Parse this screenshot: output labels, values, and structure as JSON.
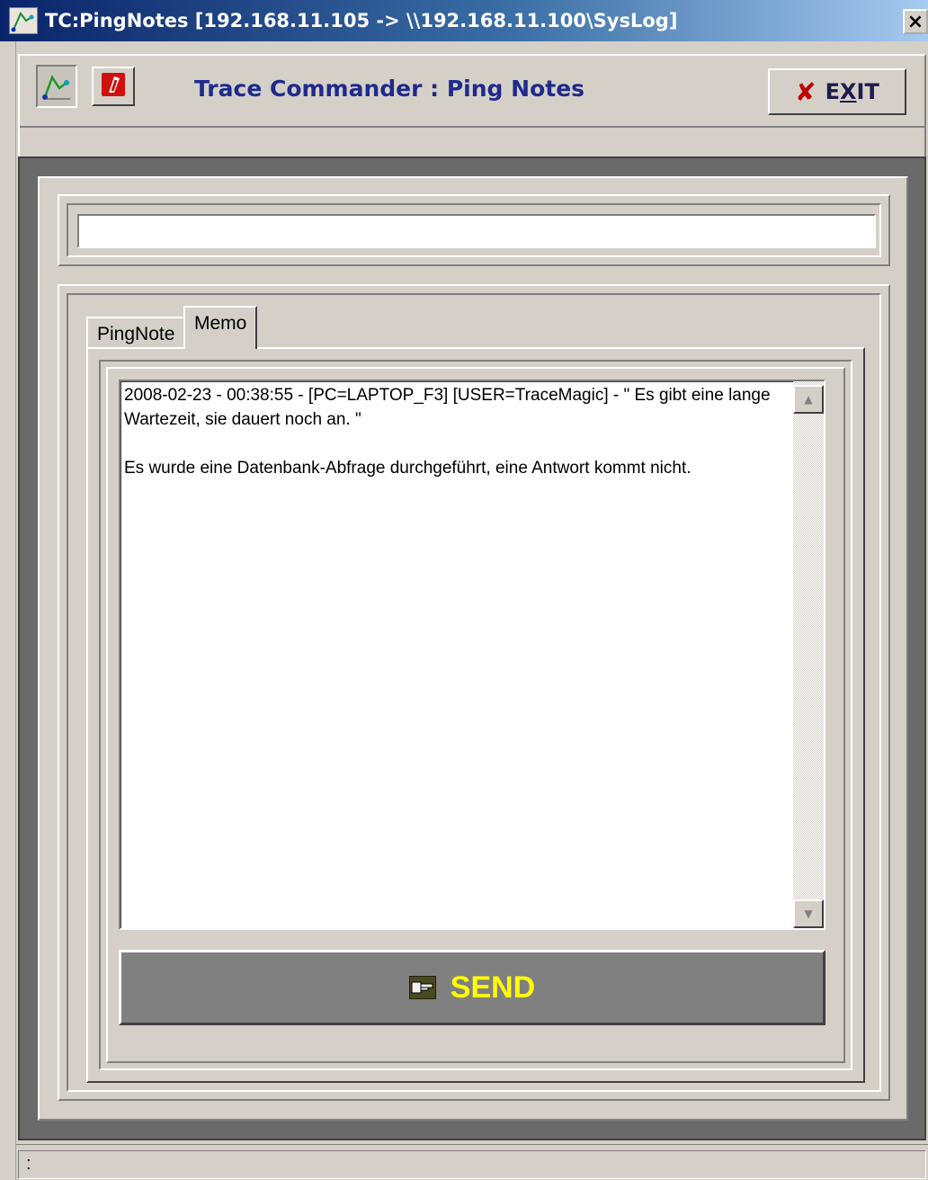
{
  "window": {
    "title": "TC:PingNotes [192.168.11.105 -> \\\\192.168.11.100\\SysLog]",
    "close_glyph": "×"
  },
  "toolbar": {
    "heading": "Trace Commander : Ping Notes",
    "exit_prefix": "E",
    "exit_underlined": "X",
    "exit_suffix": "IT",
    "icons": [
      "chart-icon",
      "ping-icon",
      "exit-x-icon"
    ]
  },
  "address": {
    "value": ""
  },
  "tabs": [
    {
      "label": "PingNote",
      "active": false
    },
    {
      "label": "Memo",
      "active": true
    }
  ],
  "memo": {
    "text": "2008-02-23 - 00:38:55 - [PC=LAPTOP_F3] [USER=TraceMagic] - \" Es gibt eine lange Wartezeit, sie dauert noch an. \"\n\nEs wurde eine Datenbank-Abfrage durchgeführt, eine Antwort kommt nicht."
  },
  "send": {
    "label": "SEND",
    "color": "#ffff00"
  },
  "statusbar": {
    "text": ":"
  }
}
